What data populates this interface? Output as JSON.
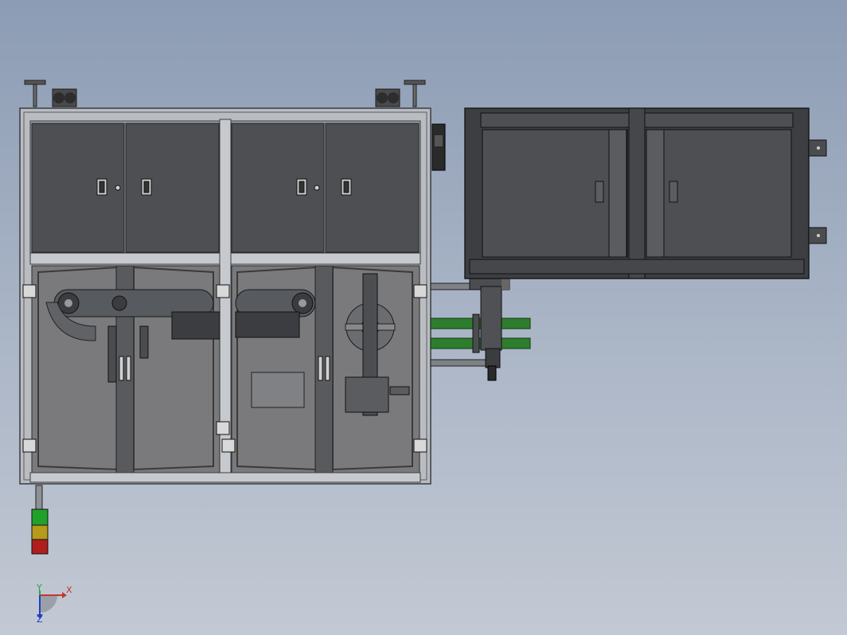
{
  "view": {
    "title": "",
    "background_top": "#8c9cb4",
    "background_bottom": "#c3c9d4"
  },
  "colors": {
    "frame": "#b9bcc0",
    "frame_edge": "#3a3d42",
    "panel": "#4d4f53",
    "panel_dark": "#3c3e42",
    "glass": "#7a7a7c",
    "conveyor": "#575a5e",
    "green_rail": "#2e7d2e",
    "tower_green": "#1fa12a",
    "tower_amber": "#b59a1c",
    "tower_red": "#b01e1e"
  },
  "triad": {
    "x_label": "X",
    "y_label": "Y",
    "z_label": "Z",
    "x_color": "#c0392b",
    "y_color": "#27a53c",
    "z_color": "#2040c0"
  },
  "signal_tower": {
    "levels": [
      "green",
      "amber",
      "red"
    ]
  }
}
